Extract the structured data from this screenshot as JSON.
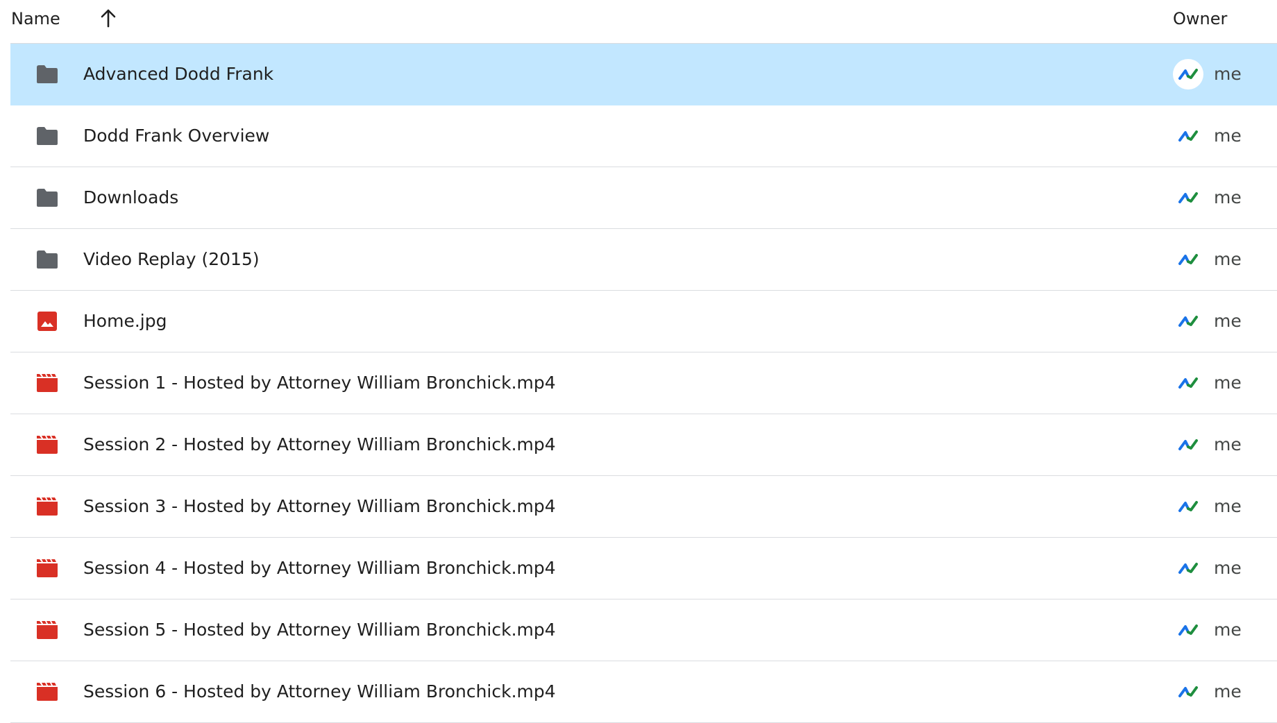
{
  "header": {
    "name_label": "Name",
    "sort_icon": "arrow-up-icon",
    "owner_label": "Owner"
  },
  "files": [
    {
      "name": "Advanced Dodd Frank",
      "type": "folder",
      "owner": "me",
      "selected": true
    },
    {
      "name": "Dodd Frank Overview",
      "type": "folder",
      "owner": "me",
      "selected": false
    },
    {
      "name": "Downloads",
      "type": "folder",
      "owner": "me",
      "selected": false
    },
    {
      "name": "Video Replay (2015)",
      "type": "folder",
      "owner": "me",
      "selected": false
    },
    {
      "name": "Home.jpg",
      "type": "image",
      "owner": "me",
      "selected": false
    },
    {
      "name": "Session 1 - Hosted by Attorney William Bronchick.mp4",
      "type": "video",
      "owner": "me",
      "selected": false
    },
    {
      "name": "Session 2 - Hosted by Attorney William Bronchick.mp4",
      "type": "video",
      "owner": "me",
      "selected": false
    },
    {
      "name": "Session 3 - Hosted by Attorney William Bronchick.mp4",
      "type": "video",
      "owner": "me",
      "selected": false
    },
    {
      "name": "Session 4 - Hosted by Attorney William Bronchick.mp4",
      "type": "video",
      "owner": "me",
      "selected": false
    },
    {
      "name": "Session 5 - Hosted by Attorney William Bronchick.mp4",
      "type": "video",
      "owner": "me",
      "selected": false
    },
    {
      "name": "Session 6 - Hosted by Attorney William Bronchick.mp4",
      "type": "video",
      "owner": "me",
      "selected": false
    }
  ],
  "colors": {
    "selected_row": "#c2e7ff",
    "folder_icon": "#5f6368",
    "media_icon": "#d93025",
    "divider": "#dadce0",
    "avatar_green": "#1e8e3e",
    "avatar_blue": "#1a73e8"
  }
}
